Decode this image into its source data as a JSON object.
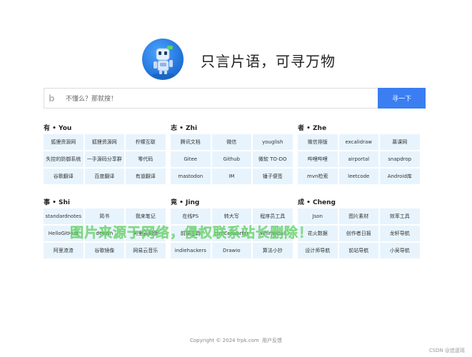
{
  "header": {
    "title": "只言片语，可寻万物"
  },
  "search": {
    "placeholder": "不懂么？那就搜！",
    "engine_icon": "b",
    "button_label": "寻一下"
  },
  "sections": [
    {
      "title": "有 • You",
      "items": [
        "狐狸资源网",
        "狐狸资源网",
        "柠檬互联",
        "失控的防御系统",
        "一手源码分享群",
        "零代码",
        "谷歌翻译",
        "百度翻译",
        "有道翻译"
      ]
    },
    {
      "title": "志 • Zhi",
      "items": [
        "腾讯文档",
        "微信",
        "youglish",
        "Gitee",
        "Github",
        "微软 TO-DO",
        "mastodon",
        "IM",
        "锤子便签"
      ]
    },
    {
      "title": "者 • Zhe",
      "items": [
        "微信排版",
        "excalidraw",
        "慕课网",
        "哔哩哔哩",
        "airportal",
        "snapdrop",
        "mvn检索",
        "leetcode",
        "Android库"
      ]
    },
    {
      "title": "事 • Shi",
      "items": [
        "standardnotes",
        "简书",
        "我来笔记",
        "HelloGitHub",
        "deepin",
        "阿里云网盘",
        "阿里渣渣",
        "谷歌镜像",
        "网易云音乐"
      ]
    },
    {
      "title": "竟 • Jing",
      "items": [
        "在线PS",
        "转大写",
        "程序员工具",
        "前端工具",
        "curlConverter",
        "whimsical",
        "indiehackers",
        "Drawio",
        "算法小抄"
      ]
    },
    {
      "title": "成 • Cheng",
      "items": [
        "Json",
        "图片素材",
        "效率工具",
        "花火数据",
        "创作者日报",
        "龙轩导航",
        "设计师导航",
        "前站导航",
        "小吴导航"
      ]
    }
  ],
  "watermark": "图片来源于网络，侵权联系站长删除！",
  "footer": {
    "copyright": "Copyright © 2024 frpk.com",
    "feedback": "用户反馈"
  },
  "corner_mark": "CSDN @追逐瑶"
}
